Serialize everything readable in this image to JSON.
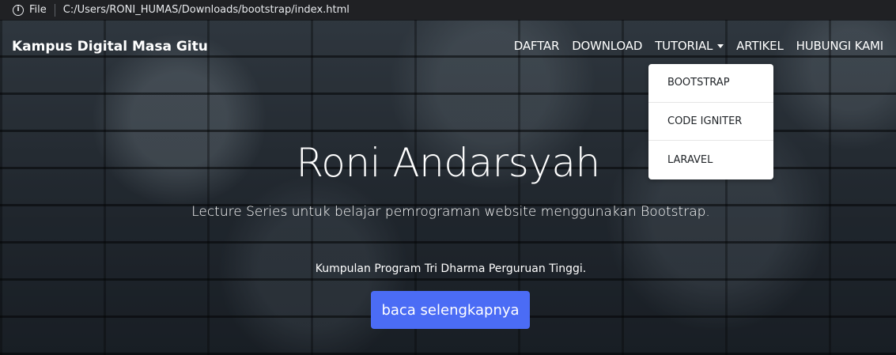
{
  "browser": {
    "file_label": "File",
    "url": "C:/Users/RONI_HUMAS/Downloads/bootstrap/index.html"
  },
  "navbar": {
    "brand": "Kampus Digital Masa Gitu",
    "links": {
      "daftar": "DAFTAR",
      "download": "DOWNLOAD",
      "tutorial": "TUTORIAL",
      "artikel": "ARTIKEL",
      "hubungi": "HUBUNGI KAMI"
    },
    "dropdown": [
      "BOOTSTRAP",
      "CODE IGNITER",
      "LARAVEL"
    ]
  },
  "hero": {
    "title": "Roni Andarsyah",
    "lead": "Lecture Series untuk belajar pemrograman website menggunakan Bootstrap.",
    "sub": "Kumpulan Program Tri Dharma Perguruan Tinggi.",
    "button": "baca selengkapnya"
  },
  "colors": {
    "button_bg": "#4b6cf5",
    "addressbar_bg": "#202124"
  },
  "icons": {
    "info": "info-icon",
    "caret": "caret-down-icon"
  }
}
